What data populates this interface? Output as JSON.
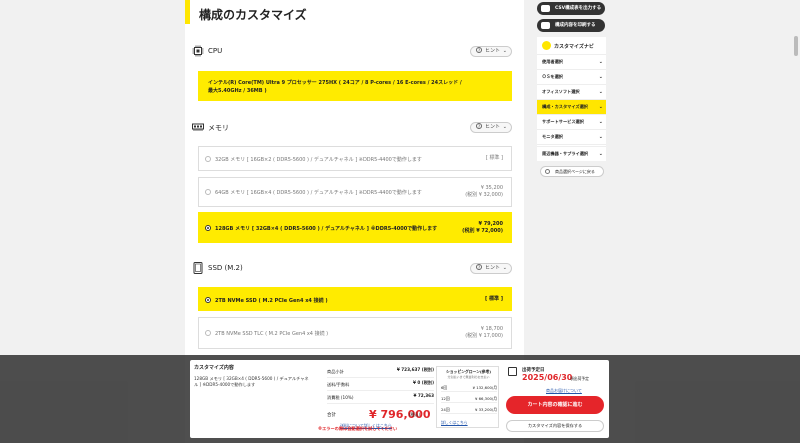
{
  "page": {
    "title": "構成のカスタマイズ",
    "top_link": ""
  },
  "sections": {
    "cpu": {
      "name": "CPU",
      "hint": "ヒント",
      "selected": "インテル(R) Core(TM) Ultra 9 プロセッサー 275HX ( 24コア / 8 P-cores / 16 E-cores / 24スレッド / 最大5.40GHz / 36MB )"
    },
    "memory": {
      "name": "メモリ",
      "hint": "ヒント",
      "options": [
        {
          "label": "32GB メモリ [ 16GB×2 ( DDR5-5600 ) / デュアルチャネル ] ※DDR5-4400で動作します",
          "price": "[ 標準 ]",
          "tax": ""
        },
        {
          "label": "64GB メモリ [ 16GB×4 ( DDR5-5600 ) / デュアルチャネル ] ※DDR5-4400で動作します",
          "price": "¥ 35,200",
          "tax": "(税別 ¥ 32,000)"
        },
        {
          "label": "128GB メモリ [ 32GB×4 ( DDR5-5600 ) / デュアルチャネル ] ※DDR5-4000で動作します",
          "price": "¥ 79,200",
          "tax": "(税別 ¥ 72,000)"
        }
      ]
    },
    "ssd": {
      "name": "SSD (M.2)",
      "hint": "ヒント",
      "options": [
        {
          "label": "2TB NVMe SSD ( M.2 PCIe Gen4 x4 接続 )",
          "price": "[ 標準 ]",
          "tax": ""
        },
        {
          "label": "2TB NVMe SSD TLC ( M.2 PCIe Gen4 x4 接続 )",
          "price": "¥ 18,700",
          "tax": "(税別 ¥ 17,000)"
        }
      ]
    }
  },
  "right": {
    "csv_button": "CSV構成表を出力する",
    "print_button": "構成内容を印刷する",
    "navi_title": "カスタマイズナビ",
    "navi_items": [
      "使用者選択",
      "ＯＳを選択",
      "オフィスソフト選択",
      "構成・カスタマイズ選択",
      "サポートサービス選択",
      "モニタ選択",
      "プリンタ選択",
      "周辺機器・サプライ選択"
    ],
    "back_button": "商品選択ページに戻る"
  },
  "summary": {
    "title": "カスタマイズ内容",
    "item": "128GB メモリ [ 32GB×4 ( DDR5-5600 ) / デュアルチャネル ] ※DDR5-4000で動作します",
    "rows": [
      {
        "label": "商品小計",
        "value": "¥ 723,637 (税別)"
      },
      {
        "label": "送料/手数料",
        "value": "¥ 0 (税別)"
      },
      {
        "label": "消費税 (10%)",
        "value": "¥ 72,363"
      }
    ],
    "total_label": "合計",
    "total_value": "¥ 796,000",
    "total_note": "(税込)",
    "total_link": "送料について詳しくはこちら",
    "warning": "※エラーの際は自動選択を試してください",
    "loan": {
      "title": "ショッピングローン(参考)",
      "sub": "分割払いまで無金利のお支払い",
      "rows": [
        {
          "n": "6回",
          "v": "¥ 132,600/月"
        },
        {
          "n": "12回",
          "v": "¥ 66,300/月"
        },
        {
          "n": "24回",
          "v": "¥ 33,200/月"
        }
      ],
      "link": "詳しくはこちら"
    },
    "ship": {
      "title": "出荷予定日",
      "date": "2025/06/30",
      "date_note": "頃出荷予定",
      "link": "商品お届けについて",
      "cta": "カート内容の確認に進む",
      "save": "カスタマイズ内容を保存する"
    }
  }
}
